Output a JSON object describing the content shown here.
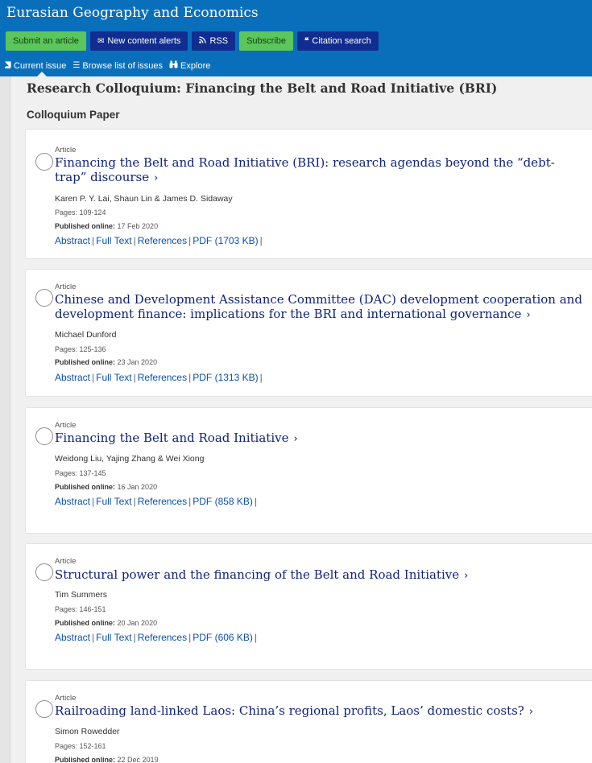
{
  "header": {
    "journal_title": "Eurasian Geography and Economics",
    "buttons": [
      {
        "label": "Submit an article",
        "icon": "",
        "style": "green"
      },
      {
        "label": "New content alerts",
        "icon": "envelope-icon",
        "style": "navy"
      },
      {
        "label": "RSS",
        "icon": "rss-icon",
        "style": "navy"
      },
      {
        "label": "Subscribe",
        "icon": "",
        "style": "green"
      },
      {
        "label": "Citation search",
        "icon": "quote-icon",
        "style": "navy"
      }
    ],
    "nav": [
      {
        "label": "Current issue",
        "icon": "book-icon"
      },
      {
        "label": "Browse list of issues",
        "icon": "list-icon"
      },
      {
        "label": "Explore",
        "icon": "binoculars-icon"
      }
    ]
  },
  "section_title": "Research Colloquium: Financing the Belt and Road Initiative (BRI)",
  "subsection_title": "Colloquium Paper",
  "link_labels": {
    "abstract": "Abstract",
    "full_text": "Full Text",
    "references": "References"
  },
  "articles": [
    {
      "type": "Article",
      "title": "Financing the Belt and Road Initiative (BRI): research agendas beyond the “debt-trap” discourse",
      "authors": "Karen P. Y. Lai, Shaun Lin & James D. Sidaway",
      "pages": "Pages: 109-124",
      "published_label": "Published online:",
      "published_date": "17 Feb 2020",
      "pdf": "PDF (1703 KB)"
    },
    {
      "type": "Article",
      "title": "Chinese and Development Assistance Committee (DAC) development cooperation and development finance: implications for the BRI and international governance",
      "authors": "Michael Dunford",
      "pages": "Pages: 125-136",
      "published_label": "Published online:",
      "published_date": "23 Jan 2020",
      "pdf": "PDF (1313 KB)"
    },
    {
      "type": "Article",
      "title": "Financing the Belt and Road Initiative",
      "authors": "Weidong Liu, Yajing Zhang & Wei Xiong",
      "pages": "Pages: 137-145",
      "published_label": "Published online:",
      "published_date": "16 Jan 2020",
      "pdf": "PDF (858 KB)"
    },
    {
      "type": "Article",
      "title": "Structural power and the financing of the Belt and Road Initiative",
      "authors": "Tim Summers",
      "pages": "Pages: 146-151",
      "published_label": "Published online:",
      "published_date": "20 Jan 2020",
      "pdf": "PDF (606 KB)"
    },
    {
      "type": "Article",
      "title": "Railroading land-linked Laos: China’s regional profits, Laos’ domestic costs?",
      "authors": "Simon Rowedder",
      "pages": "Pages: 152-161",
      "published_label": "Published online:",
      "published_date": "22 Dec 2019",
      "pdf": ""
    }
  ]
}
